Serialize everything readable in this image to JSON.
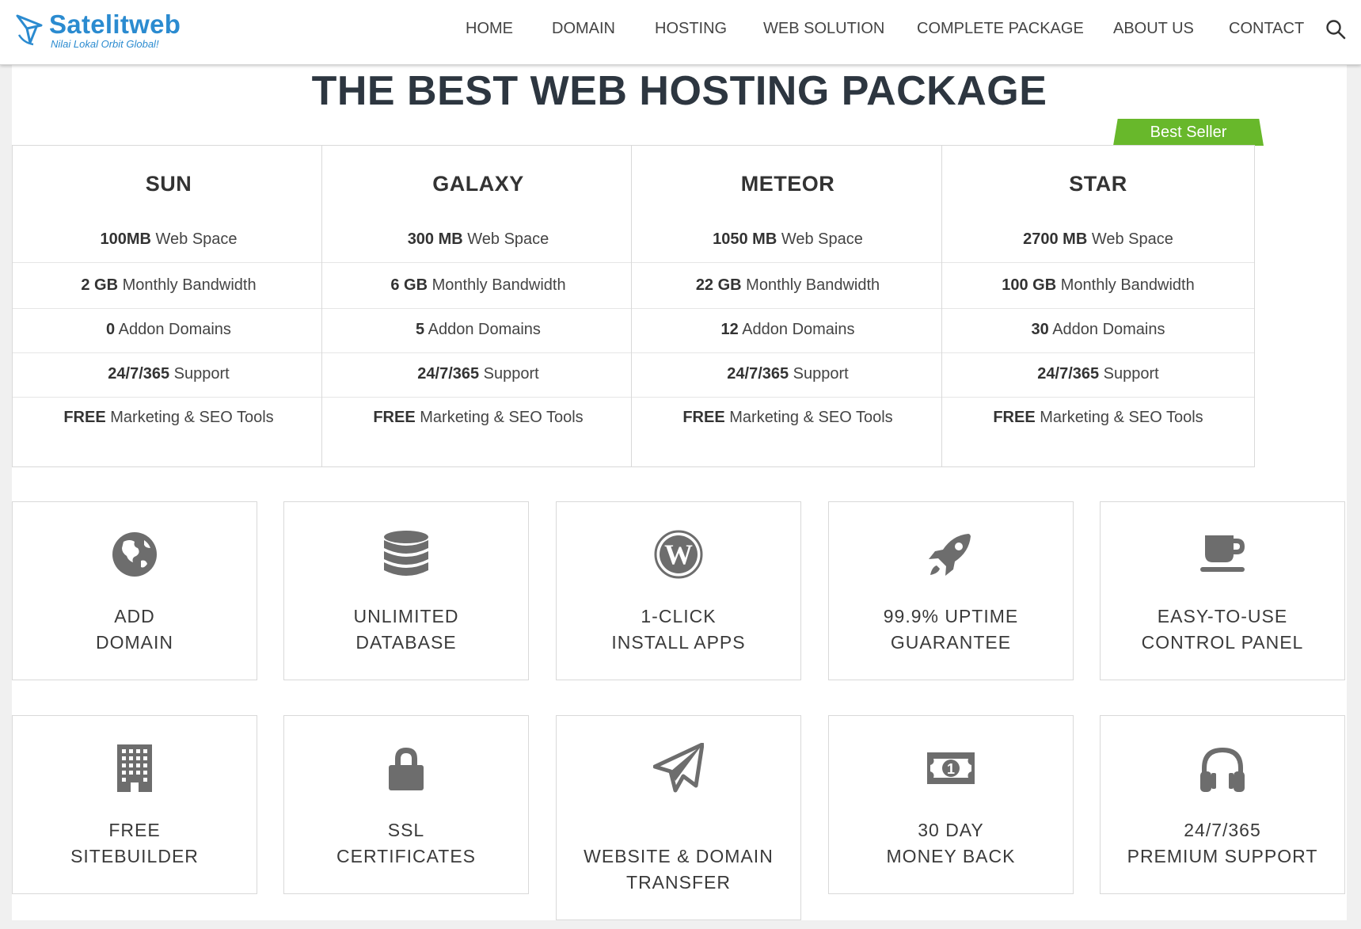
{
  "brand": {
    "name": "Satelitweb",
    "tagline": "Nilai Lokal Orbit Global!",
    "color": "#2b8bd0"
  },
  "nav": {
    "items": [
      "HOME",
      "DOMAIN",
      "HOSTING",
      "WEB SOLUTION",
      "COMPLETE PACKAGE",
      "ABOUT US",
      "CONTACT"
    ],
    "search_icon": "search-icon"
  },
  "page": {
    "title": "THE BEST WEB HOSTING PACKAGE",
    "badge": "Best Seller",
    "badge_color": "#68b82b"
  },
  "plans": [
    {
      "name": "SUN",
      "features": [
        {
          "bold": "100MB",
          "text": " Web Space"
        },
        {
          "bold": "2 GB",
          "text": " Monthly Bandwidth"
        },
        {
          "bold": "0",
          "text": " Addon Domains"
        },
        {
          "bold": "24/7/365",
          "text": " Support"
        },
        {
          "bold": "FREE",
          "text": " Marketing & SEO Tools"
        }
      ]
    },
    {
      "name": "GALAXY",
      "features": [
        {
          "bold": "300 MB",
          "text": " Web Space"
        },
        {
          "bold": "6 GB",
          "text": " Monthly Bandwidth"
        },
        {
          "bold": "5",
          "text": " Addon Domains"
        },
        {
          "bold": "24/7/365",
          "text": " Support"
        },
        {
          "bold": "FREE",
          "text": " Marketing & SEO Tools"
        }
      ]
    },
    {
      "name": "METEOR",
      "features": [
        {
          "bold": "1050 MB",
          "text": " Web Space"
        },
        {
          "bold": "22 GB",
          "text": " Monthly Bandwidth"
        },
        {
          "bold": "12",
          "text": " Addon Domains"
        },
        {
          "bold": "24/7/365",
          "text": " Support"
        },
        {
          "bold": "FREE",
          "text": " Marketing & SEO Tools"
        }
      ]
    },
    {
      "name": "STAR",
      "features": [
        {
          "bold": "2700 MB",
          "text": " Web Space"
        },
        {
          "bold": "100 GB",
          "text": " Monthly Bandwidth"
        },
        {
          "bold": "30",
          "text": " Addon Domains"
        },
        {
          "bold": "24/7/365",
          "text": " Support"
        },
        {
          "bold": "FREE",
          "text": " Marketing & SEO Tools"
        }
      ]
    }
  ],
  "tiles": [
    {
      "icon": "globe-icon",
      "lines": [
        "ADD",
        "DOMAIN"
      ]
    },
    {
      "icon": "database-icon",
      "lines": [
        "UNLIMITED",
        "DATABASE"
      ]
    },
    {
      "icon": "wordpress-icon",
      "lines": [
        "1-CLICK",
        "INSTALL APPS"
      ]
    },
    {
      "icon": "rocket-icon",
      "lines": [
        "99.9% UPTIME",
        "GUARANTEE"
      ]
    },
    {
      "icon": "coffee-cup-icon",
      "lines": [
        "EASY-TO-USE",
        "CONTROL PANEL"
      ]
    },
    {
      "icon": "building-icon",
      "lines": [
        "FREE",
        "SITEBUILDER"
      ]
    },
    {
      "icon": "lock-icon",
      "lines": [
        "SSL",
        "CERTIFICATES"
      ]
    },
    {
      "icon": "paper-plane-icon",
      "lines": [
        "WEBSITE & DOMAIN",
        "TRANSFER"
      ]
    },
    {
      "icon": "money-icon",
      "lines": [
        "30 DAY",
        "MONEY BACK"
      ]
    },
    {
      "icon": "headphones-icon",
      "lines": [
        "24/7/365",
        "PREMIUM SUPPORT"
      ]
    }
  ],
  "colors": {
    "icon": "#6d6d6d",
    "title": "#2d3640"
  }
}
